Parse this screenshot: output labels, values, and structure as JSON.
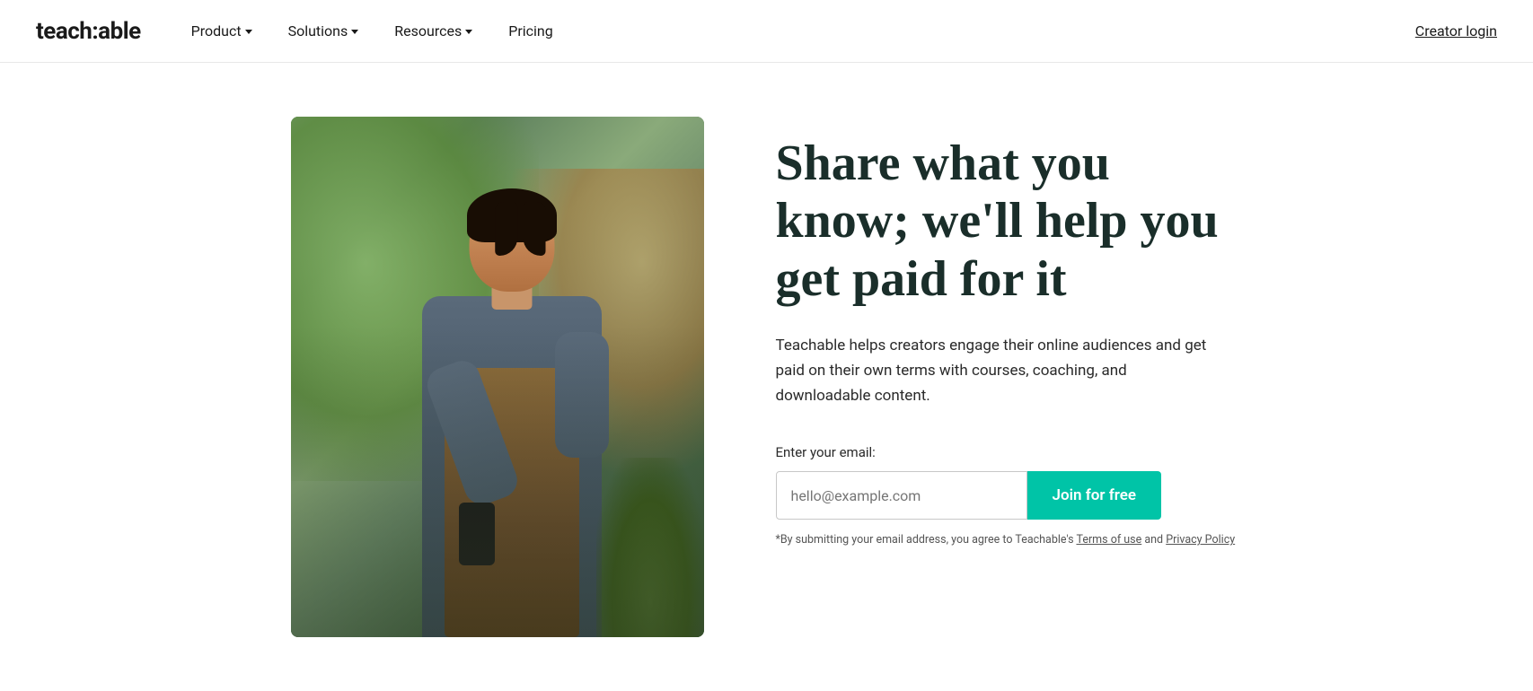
{
  "nav": {
    "logo": "teach:able",
    "links": [
      {
        "label": "Product",
        "hasDropdown": true
      },
      {
        "label": "Solutions",
        "hasDropdown": true
      },
      {
        "label": "Resources",
        "hasDropdown": true
      },
      {
        "label": "Pricing",
        "hasDropdown": false
      }
    ],
    "creator_login": "Creator login"
  },
  "hero": {
    "title": "Share what you know; we'll help you get paid for it",
    "description": "Teachable helps creators engage their online audiences and get paid on their own terms with courses, coaching, and downloadable content.",
    "email_label": "Enter your email:",
    "email_placeholder": "hello@example.com",
    "join_button": "Join for free",
    "terms_prefix": "*By submitting your email address, you agree to Teachable's ",
    "terms_link1": "Terms of use",
    "terms_and": " and ",
    "terms_link2": "Privacy Policy"
  }
}
